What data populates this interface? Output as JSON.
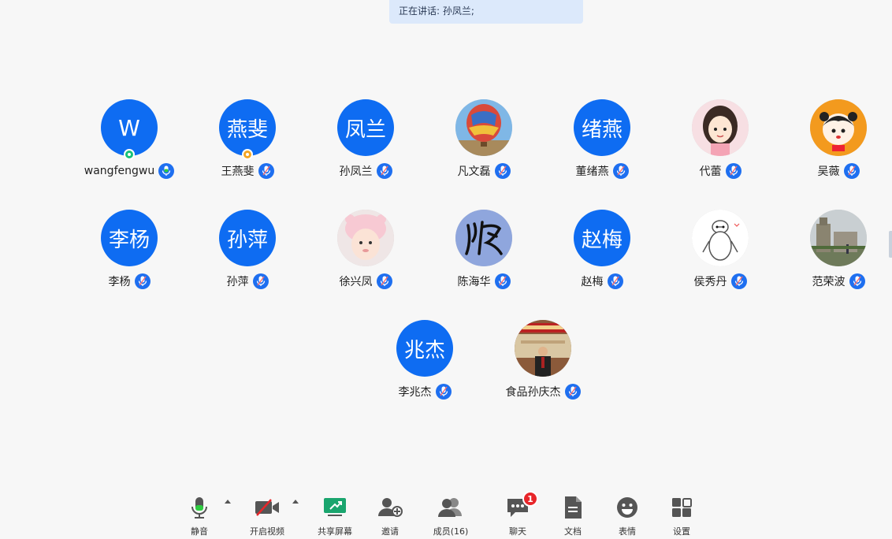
{
  "speaking_banner": "正在讲话: 孙凤兰;",
  "participants": [
    {
      "name": "wangfengwu",
      "avatar_text": "W",
      "avatar_kind": "initial",
      "status": "green"
    },
    {
      "name": "王燕斐",
      "avatar_text": "燕斐",
      "avatar_kind": "initial",
      "status": "orange"
    },
    {
      "name": "孙凤兰",
      "avatar_text": "凤兰",
      "avatar_kind": "initial"
    },
    {
      "name": "凡文磊",
      "avatar_kind": "photo-balloon"
    },
    {
      "name": "董绪燕",
      "avatar_text": "绪燕",
      "avatar_kind": "initial"
    },
    {
      "name": "代蕾",
      "avatar_kind": "photo-girl"
    },
    {
      "name": "吴薇",
      "avatar_kind": "photo-cartoon"
    },
    {
      "name": "李杨",
      "avatar_text": "李杨",
      "avatar_kind": "initial"
    },
    {
      "name": "孙萍",
      "avatar_text": "孙萍",
      "avatar_kind": "initial"
    },
    {
      "name": "徐兴凤",
      "avatar_kind": "photo-baby"
    },
    {
      "name": "陈海华",
      "avatar_kind": "photo-calligraphy"
    },
    {
      "name": "赵梅",
      "avatar_text": "赵梅",
      "avatar_kind": "initial"
    },
    {
      "name": "侯秀丹",
      "avatar_kind": "photo-robot"
    },
    {
      "name": "范荣波",
      "avatar_kind": "photo-building"
    },
    {
      "name": "李兆杰",
      "avatar_text": "兆杰",
      "avatar_kind": "initial"
    },
    {
      "name": "食品孙庆杰",
      "avatar_kind": "photo-hall"
    }
  ],
  "toolbar": {
    "mute": "静音",
    "video": "开启视频",
    "share": "共享屏幕",
    "invite": "邀请",
    "members": "成员(16)",
    "chat": "聊天",
    "chat_badge": "1",
    "docs": "文档",
    "emoji": "表情",
    "settings": "设置"
  },
  "colors": {
    "accent": "#0e6cf2",
    "share_green": "#1aa56e",
    "badge_red": "#e8262a"
  }
}
